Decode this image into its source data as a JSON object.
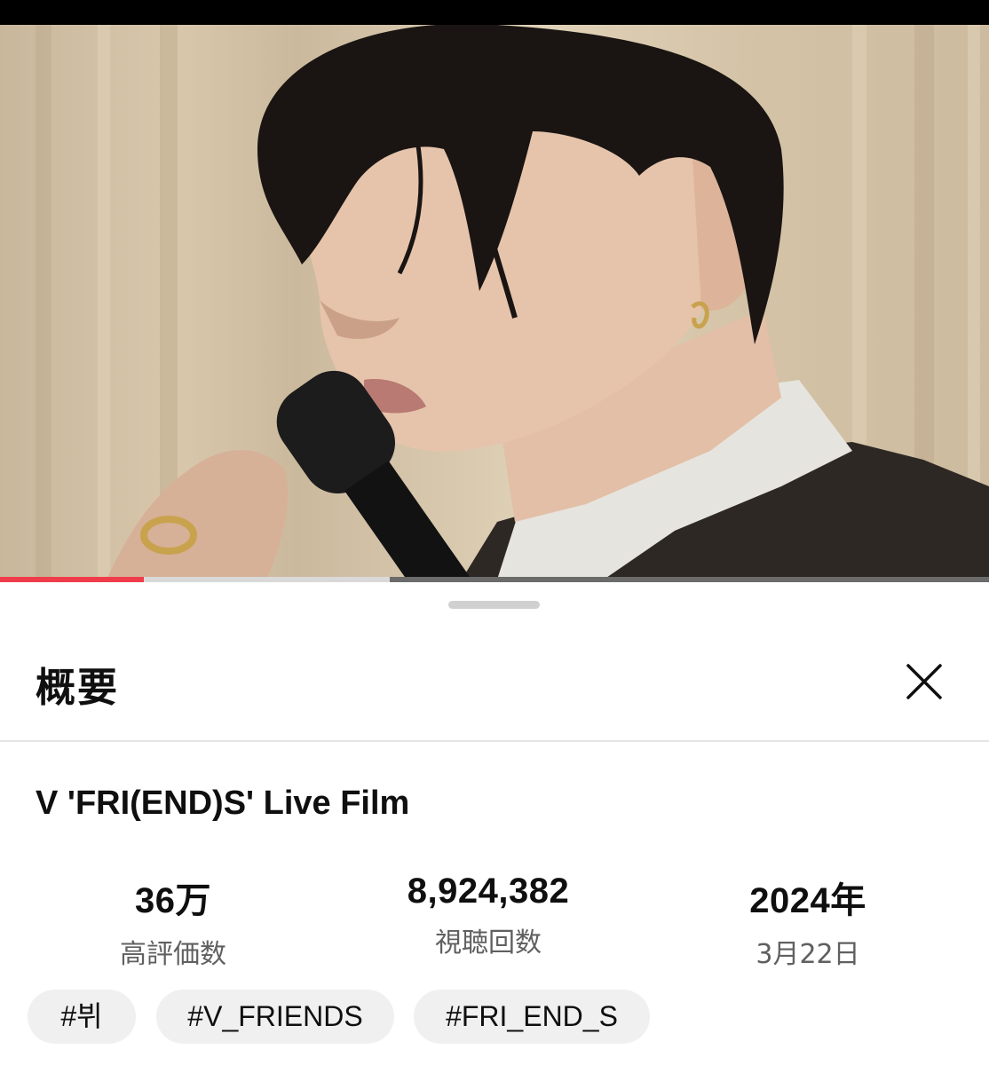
{
  "video": {
    "progress_played": 0.145,
    "progress_buffered": 0.394
  },
  "sheet": {
    "title": "概要",
    "close_icon": "close-icon",
    "video_title": "V 'FRI(END)S' Live Film",
    "stats": [
      {
        "value": "36万",
        "label": "高評価数"
      },
      {
        "value": "8,924,382",
        "label": "視聴回数"
      },
      {
        "value": "2024年",
        "label": "3月22日"
      }
    ],
    "hashtags": [
      "#뷔",
      "#V_FRIENDS",
      "#FRI_END_S"
    ]
  },
  "colors": {
    "progress_played": "#f03c4a",
    "chip_bg": "#f0f0f0",
    "secondary_text": "#606060"
  }
}
